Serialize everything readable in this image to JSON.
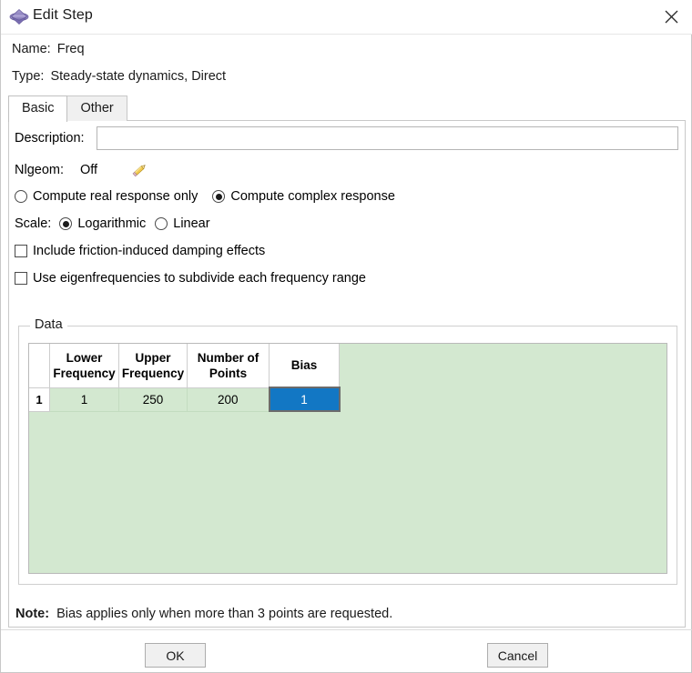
{
  "window": {
    "title": "Edit Step",
    "icon": "step-diamond-icon",
    "close_label": "✕"
  },
  "header": {
    "name_label": "Name:",
    "name_value": "Freq",
    "type_label": "Type:",
    "type_value": "Steady-state dynamics, Direct"
  },
  "tabs": [
    {
      "label": "Basic",
      "active": true
    },
    {
      "label": "Other",
      "active": false
    }
  ],
  "basic": {
    "description_label": "Description:",
    "description_value": "",
    "description_placeholder": "",
    "nlgeom_label": "Nlgeom:",
    "nlgeom_value": "Off",
    "edit_icon": "pencil-icon",
    "response_options": [
      {
        "label": "Compute real response only",
        "selected": false
      },
      {
        "label": "Compute complex response",
        "selected": true
      }
    ],
    "scale_label": "Scale:",
    "scale_options": [
      {
        "label": "Logarithmic",
        "selected": true
      },
      {
        "label": "Linear",
        "selected": false
      }
    ],
    "checkboxes": [
      {
        "label": "Include friction-induced damping effects",
        "checked": false
      },
      {
        "label": "Use eigenfrequencies to subdivide each frequency range",
        "checked": false
      }
    ]
  },
  "data_group": {
    "title": "Data",
    "columns": [
      "Lower Frequency",
      "Upper Frequency",
      "Number of Points",
      "Bias"
    ],
    "rows": [
      {
        "index": "1",
        "values": [
          "1",
          "250",
          "200",
          "1"
        ]
      }
    ],
    "selected_cell": {
      "row": 0,
      "col": 3
    },
    "selection_color": "#1277c4",
    "grid_background": "#d3e8d0"
  },
  "note": {
    "prefix": "Note:",
    "text": "Bias applies only when more than 3 points are requested."
  },
  "footer": {
    "ok_label": "OK",
    "cancel_label": "Cancel"
  }
}
